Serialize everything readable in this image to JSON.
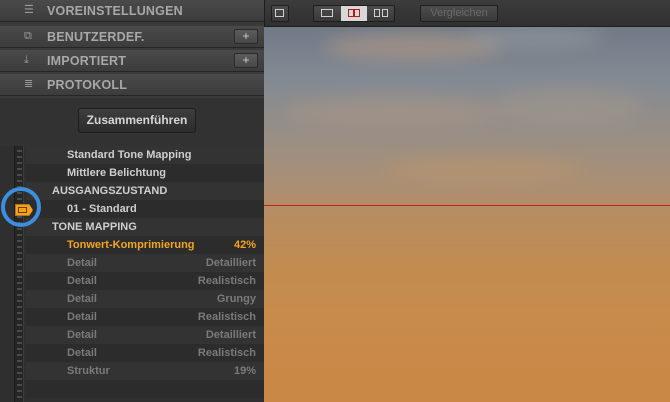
{
  "sections": [
    {
      "label": "VOREINSTELLUNGEN",
      "icon": "presets-list-icon",
      "has_add": false
    },
    {
      "label": "BENUTZERDEF.",
      "icon": "user-presets-icon",
      "has_add": true
    },
    {
      "label": "IMPORTIERT",
      "icon": "import-icon",
      "has_add": true
    },
    {
      "label": "PROTOKOLL",
      "icon": "history-log-icon",
      "has_add": false
    }
  ],
  "add_label": "+",
  "merge_button": "Zusammenführen",
  "history": [
    {
      "label": "Standard Tone Mapping",
      "value": "",
      "kind": "normal"
    },
    {
      "label": "Mittlere Belichtung",
      "value": "",
      "kind": "normal"
    },
    {
      "label": "AUSGANGSZUSTAND",
      "value": "",
      "kind": "group"
    },
    {
      "label": "01 - Standard",
      "value": "",
      "kind": "normal"
    },
    {
      "label": "TONE MAPPING",
      "value": "",
      "kind": "group"
    },
    {
      "label": "Tonwert-Komprimierung",
      "value": "42%",
      "kind": "active"
    },
    {
      "label": "Detail",
      "value": "Detailliert",
      "kind": "dim"
    },
    {
      "label": "Detail",
      "value": "Realistisch",
      "kind": "dim"
    },
    {
      "label": "Detail",
      "value": "Grungy",
      "kind": "dim"
    },
    {
      "label": "Detail",
      "value": "Realistisch",
      "kind": "dim"
    },
    {
      "label": "Detail",
      "value": "Detailliert",
      "kind": "dim"
    },
    {
      "label": "Detail",
      "value": "Realistisch",
      "kind": "dim"
    },
    {
      "label": "Struktur",
      "value": "19%",
      "kind": "dim"
    },
    {
      "label": "",
      "value": "",
      "kind": "dim"
    }
  ],
  "toolbar": {
    "compare_label": "Vergleichen",
    "view_modes": [
      "single-view",
      "split-view",
      "side-by-side-view"
    ],
    "active_view": "split-view"
  },
  "colors": {
    "accent": "#f2a51e",
    "selection_ring": "#3e8edf",
    "split_line": "#c81f1f"
  }
}
